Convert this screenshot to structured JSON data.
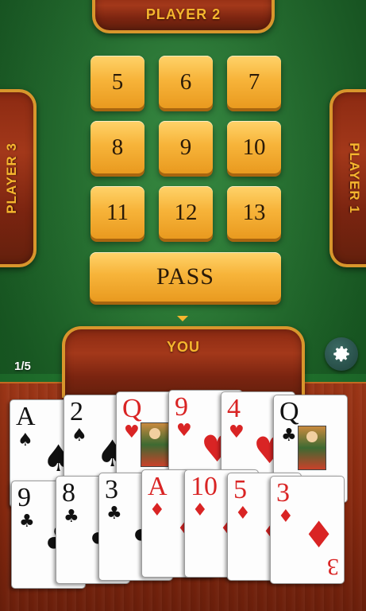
{
  "players": {
    "top": "PLAYER 2",
    "left": "PLAYER 3",
    "right": "PLAYER 1",
    "bottom": "YOU"
  },
  "bids": [
    "5",
    "6",
    "7",
    "8",
    "9",
    "10",
    "11",
    "12",
    "13"
  ],
  "pass_label": "PASS",
  "round_counter": "1/5",
  "settings_icon": "gear-icon",
  "colors": {
    "felt": "#1f6e2b",
    "wood": "#8c2a12",
    "gold": "#f6b62e",
    "button": "#f7b43a",
    "suit_red": "#d92424",
    "suit_black": "#111111"
  },
  "hand": {
    "row1": [
      {
        "rank": "A",
        "suit": "♠",
        "color": "black"
      },
      {
        "rank": "2",
        "suit": "♠",
        "color": "black"
      },
      {
        "rank": "Q",
        "suit": "♥",
        "color": "red",
        "face": true
      },
      {
        "rank": "9",
        "suit": "♥",
        "color": "red"
      },
      {
        "rank": "4",
        "suit": "♥",
        "color": "red"
      },
      {
        "rank": "Q",
        "suit": "♣",
        "color": "black",
        "face": true
      }
    ],
    "row2": [
      {
        "rank": "9",
        "suit": "♣",
        "color": "black"
      },
      {
        "rank": "8",
        "suit": "♣",
        "color": "black"
      },
      {
        "rank": "3",
        "suit": "♣",
        "color": "black"
      },
      {
        "rank": "A",
        "suit": "♦",
        "color": "red"
      },
      {
        "rank": "10",
        "suit": "♦",
        "color": "red"
      },
      {
        "rank": "5",
        "suit": "♦",
        "color": "red"
      },
      {
        "rank": "3",
        "suit": "♦",
        "color": "red"
      }
    ]
  }
}
